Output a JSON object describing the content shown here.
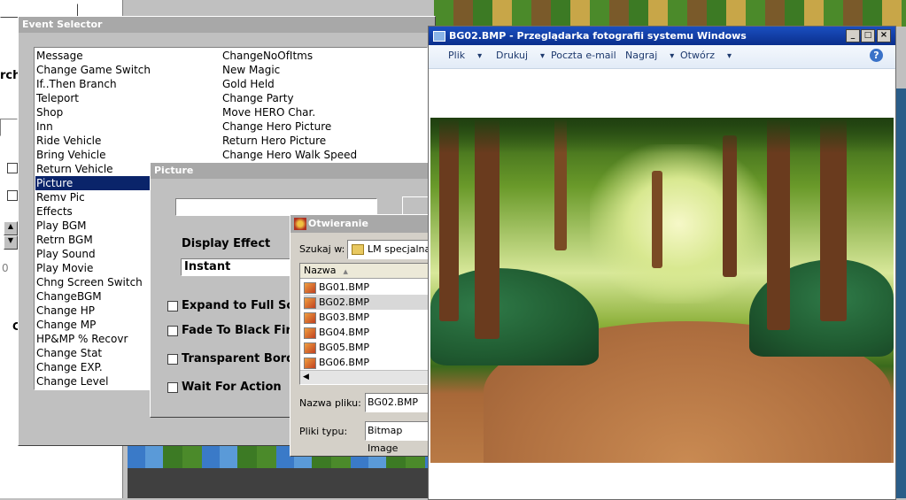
{
  "background_app": {
    "left_panel_text": "rch",
    "left_panel_small": "0",
    "left_panel_c": "C"
  },
  "event_selector": {
    "title": "Event Selector",
    "col1": [
      "Message",
      "Change Game Switch",
      "If..Then Branch",
      "Teleport",
      "Shop",
      "Inn",
      "Ride Vehicle",
      "Bring Vehicle",
      "Return Vehicle",
      "Picture",
      "Remv Pic",
      "Effects",
      "Play BGM",
      "Retrn BGM",
      "Play Sound",
      "Play Movie",
      "Chng Screen Switch",
      "ChangeBGM",
      "Change HP",
      "Change MP",
      "HP&MP % Recovr",
      "Change Stat",
      "Change EXP.",
      "Change Level"
    ],
    "col2": [
      "ChangeNoOfItms",
      "New Magic",
      "Gold Held",
      "Change Party",
      "Move HERO Char.",
      "Change Hero Picture",
      "Return Hero Picture",
      "Change Hero Walk Speed"
    ],
    "selected_index": 9
  },
  "picture_dialog": {
    "title": "Picture",
    "name_value": "",
    "display_effect_label": "Display Effect",
    "display_effect_value": "Instant",
    "checks": [
      {
        "label": "Expand to Full Scre",
        "checked": false
      },
      {
        "label": "Fade To Black First",
        "checked": false
      },
      {
        "label": "Transparent Border",
        "checked": false
      },
      {
        "label": "Wait For Action",
        "checked": false
      }
    ]
  },
  "open_dialog": {
    "title": "Otwieranie",
    "look_in_label": "Szukaj w:",
    "look_in_value": "LM specjalna",
    "column_header": "Nazwa",
    "files": [
      "BG01.BMP",
      "BG02.BMP",
      "BG03.BMP",
      "BG04.BMP",
      "BG05.BMP",
      "BG06.BMP"
    ],
    "selected_index": 1,
    "filename_label": "Nazwa pliku:",
    "filename_value": "BG02.BMP",
    "filetype_label": "Pliki typu:",
    "filetype_value": "Bitmap Image"
  },
  "photo_viewer": {
    "title": "BG02.BMP - Przeglądarka fotografii systemu Windows",
    "menu": [
      {
        "label": "Plik",
        "has_arrow": true
      },
      {
        "label": "Drukuj",
        "has_arrow": true
      },
      {
        "label": "Poczta e-mail",
        "has_arrow": false
      },
      {
        "label": "Nagraj",
        "has_arrow": true
      },
      {
        "label": "Otwórz",
        "has_arrow": true
      }
    ],
    "help_icon": "?"
  },
  "icons": {
    "folder": "folder-icon",
    "image_file": "bitmap-file-icon",
    "app": "app-icon"
  },
  "colors": {
    "selection": "#0a246a",
    "titlebar_inactive": "#a8a8a8",
    "viewer_titlebar": "#0b2f8c"
  }
}
